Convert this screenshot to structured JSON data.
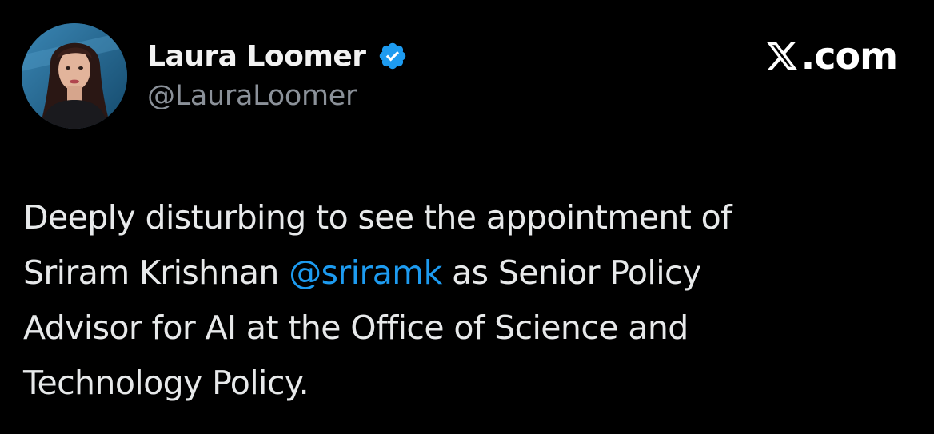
{
  "author": {
    "display_name": "Laura Loomer",
    "handle": "@LauraLoomer",
    "verified": true,
    "avatar_icon": "profile-photo"
  },
  "brand": {
    "logo_icon": "x-logo-icon",
    "text": ".com"
  },
  "tweet": {
    "lines": [
      {
        "segments": [
          {
            "text": "Deeply disturbing to see the appointment of",
            "type": "text"
          }
        ]
      },
      {
        "segments": [
          {
            "text": "Sriram Krishnan ",
            "type": "text"
          },
          {
            "text": "@sriramk",
            "type": "mention"
          },
          {
            "text": " as Senior Policy",
            "type": "text"
          }
        ]
      },
      {
        "segments": [
          {
            "text": "Advisor for AI at the Office of Science and",
            "type": "text"
          }
        ]
      },
      {
        "segments": [
          {
            "text": "Technology Policy.",
            "type": "text"
          }
        ]
      }
    ]
  },
  "colors": {
    "background": "#000000",
    "text": "#e7e9ea",
    "mention": "#1d9bf0",
    "handle": "#8b9199",
    "verified_badge": "#1d9bf0"
  }
}
